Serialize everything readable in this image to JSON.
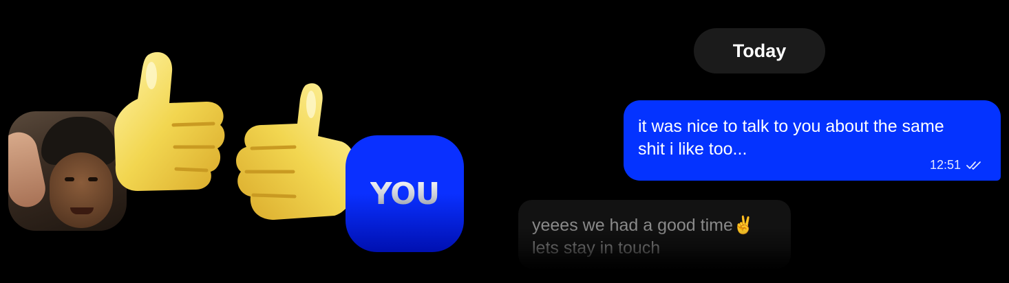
{
  "date_separator": "Today",
  "outgoing_message": {
    "text": "it was nice to talk to you about the same\nshit i like too...",
    "time": "12:51",
    "status_icon": "double-check-icon"
  },
  "incoming_message": {
    "text": "yeees we had a good time✌\nlets stay in touch"
  },
  "artwork": {
    "you_label": "YOU",
    "thumb_icon": "thumbs-up-icon",
    "accent": "#0433ff"
  }
}
